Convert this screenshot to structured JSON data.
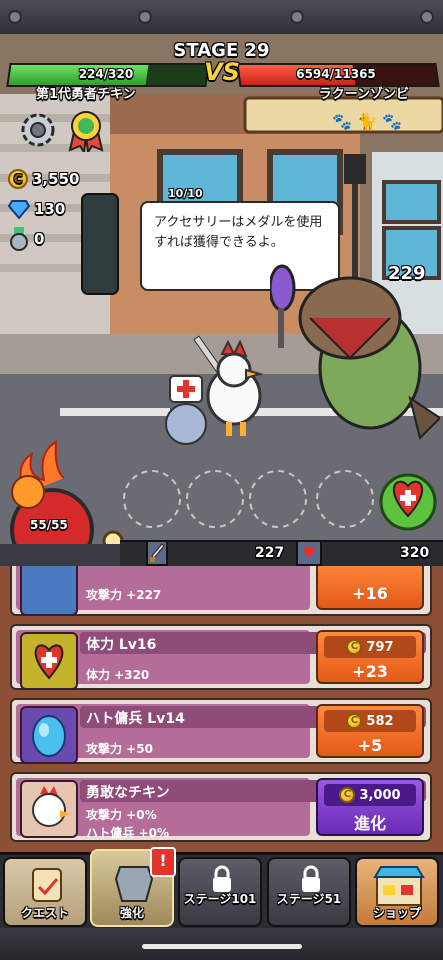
{
  "stage": {
    "title": "STAGE 29"
  },
  "player": {
    "hp_text": "224/320",
    "hp_fraction": 0.7,
    "name": "第1代勇者チキン"
  },
  "enemy": {
    "hp_text": "6594/11365",
    "hp_fraction": 0.58,
    "name": "ラクーンゾンビ"
  },
  "vs_label": "VS",
  "resources": {
    "gold": "3,550",
    "gems": "130",
    "medals": "0"
  },
  "ally": {
    "hp_text": "10/10"
  },
  "speech": {
    "text": "アクセサリーはメダルを使用すれば獲得できるよ。"
  },
  "building_number": "229",
  "potion": {
    "count": "55/55"
  },
  "power": {
    "attack": "227",
    "health": "320"
  },
  "upgrades": [
    {
      "title": "",
      "desc": "攻撃力 +227",
      "desc2": "",
      "price": "",
      "gain": "+16",
      "icon": "sword-icon",
      "button": "buy"
    },
    {
      "title": "体力 Lv16",
      "desc": "体力 +320",
      "desc2": "",
      "price": "797",
      "gain": "+23",
      "icon": "heart-icon",
      "button": "buy"
    },
    {
      "title": "ハト傭兵 Lv14",
      "desc": "攻撃力 +50",
      "desc2": "",
      "price": "582",
      "gain": "+5",
      "icon": "egg-icon",
      "button": "buy"
    },
    {
      "title": "勇敢なチキン",
      "desc": "攻撃力 +0%",
      "desc2": "ハト傭兵 +0%",
      "price": "3,000",
      "gain": "進化",
      "icon": "rooster-icon",
      "button": "evolve"
    }
  ],
  "nav": [
    {
      "label": "クエスト",
      "icon": "scroll-icon"
    },
    {
      "label": "強化",
      "icon": "armor-icon",
      "alert": "!"
    },
    {
      "label": "ステージ101",
      "icon": "lock-icon"
    },
    {
      "label": "ステージ51",
      "icon": "lock-icon"
    },
    {
      "label": "ショップ",
      "icon": "shop-icon"
    }
  ],
  "colors": {
    "player_hp": "#3fc23a",
    "enemy_hp": "#e23a2a",
    "buy": "#f07028",
    "evolve": "#7d3fc9"
  }
}
